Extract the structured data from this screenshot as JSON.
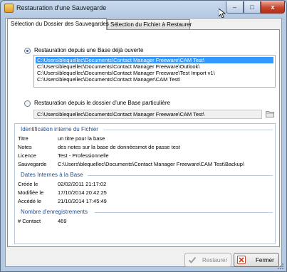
{
  "window": {
    "title": "Restauration d'une Sauvegarde",
    "controls": {
      "minimize": "–",
      "maximize": "□",
      "close": "x"
    }
  },
  "tabs": [
    {
      "label": "Sélection du Dossier des Sauvegardes",
      "active": true
    },
    {
      "label": "Sélection du Fichier à Restaurer",
      "active": false
    }
  ],
  "source": {
    "option_db_label": "Restauration depuis une Base déjà ouverte",
    "option_db_checked": true,
    "databases": [
      {
        "path": "C:\\Users\\blequellec\\Documents\\Contact Manager Freeware\\CAM Test\\",
        "selected": true
      },
      {
        "path": "C:\\Users\\blequellec\\Documents\\Contact Manager Freeware\\Outlook\\",
        "selected": false
      },
      {
        "path": "C:\\Users\\blequellec\\Documents\\Contact Manager Freeware\\Test Import v1\\",
        "selected": false
      },
      {
        "path": "C:\\Users\\blequellec\\Documents\\Contact Manager\\CAM Test\\",
        "selected": false
      }
    ],
    "option_folder_label": "Restauration depuis le dossier d'une Base particulière",
    "option_folder_checked": false,
    "folder_path": "C:\\Users\\blequellec\\Documents\\Contact Manager Freeware\\CAM Test\\"
  },
  "identification": {
    "title": "Identification interne du Fichier",
    "rows": [
      {
        "label": "Titre",
        "value": "un titre pour la base"
      },
      {
        "label": "Notes",
        "value": "des notes sur la base de donnéesmot de passe test"
      },
      {
        "label": "Licence",
        "value": "Test - Professionnelle"
      },
      {
        "label": "Sauvegarde",
        "value": "C:\\Users\\blequellec\\Documents\\Contact Manager Freeware\\CAM Test\\Backup\\"
      }
    ]
  },
  "dates": {
    "title": "Dates Internes à la Base",
    "rows": [
      {
        "label": "Créée le",
        "value": "02/02/2011 21:17:02"
      },
      {
        "label": "Modifiée le",
        "value": "17/10/2014 20:42:25"
      },
      {
        "label": "Accédé le",
        "value": "21/10/2014 17:45:49"
      }
    ]
  },
  "records": {
    "title": "Nombre d'enregistrements",
    "rows": [
      {
        "label": "# Contact",
        "value": "469"
      }
    ]
  },
  "buttons": {
    "restore_label": "Restaurer",
    "restore_enabled": false,
    "close_label": "Fermer"
  },
  "icons": {
    "app": "backup-restore-icon",
    "folder": "folder-icon",
    "restore": "checkmark-icon",
    "close": "red-x-icon"
  },
  "colors": {
    "selection": "#3399ff",
    "section_title": "#1d4f91",
    "close_button_red": "#c7442b"
  }
}
